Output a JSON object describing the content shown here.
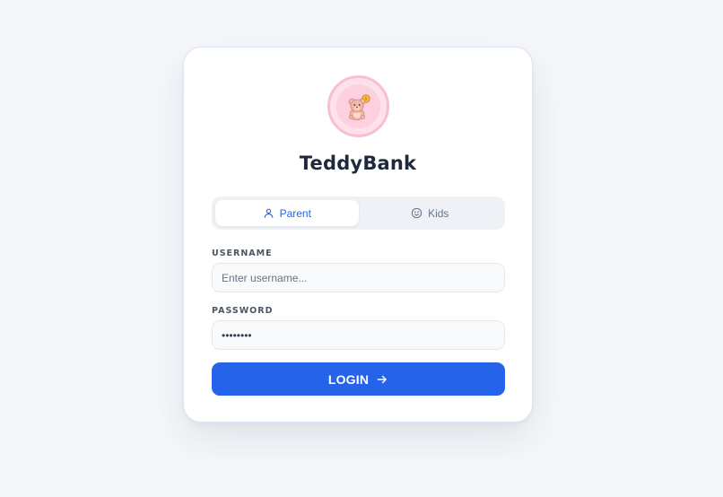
{
  "app": {
    "name": "TeddyBank",
    "logo_icon": "teddy-bear-icon",
    "accent_color": "#2563eb"
  },
  "tabs": [
    {
      "label": "Parent",
      "icon": "user-icon",
      "active": true
    },
    {
      "label": "Kids",
      "icon": "smile-icon",
      "active": false
    }
  ],
  "form": {
    "username": {
      "label": "USERNAME",
      "placeholder": "Enter username...",
      "value": ""
    },
    "password": {
      "label": "PASSWORD",
      "value": "••••••••"
    },
    "submit_label": "LOGIN",
    "submit_icon": "arrow-right-icon"
  }
}
